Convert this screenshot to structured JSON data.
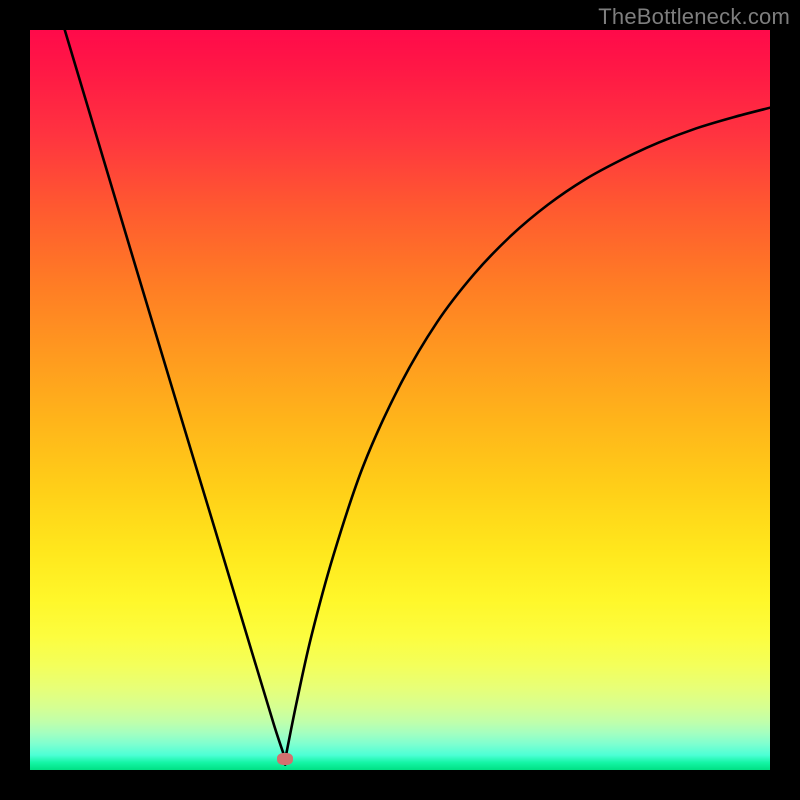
{
  "watermark": "TheBottleneck.com",
  "colors": {
    "outer": "#000000",
    "curve": "#000000",
    "marker": "#d2716f",
    "watermark": "#7e7e7e"
  },
  "marker": {
    "x_frac": 0.345,
    "y_frac": 0.985
  },
  "chart_data": {
    "type": "line",
    "title": "",
    "xlabel": "",
    "ylabel": "",
    "xlim": [
      0,
      1
    ],
    "ylim": [
      0,
      1
    ],
    "series": [
      {
        "name": "left-branch",
        "x": [
          0.047,
          0.1,
          0.15,
          0.2,
          0.25,
          0.3,
          0.33,
          0.345
        ],
        "values": [
          1.0,
          0.823,
          0.656,
          0.49,
          0.325,
          0.159,
          0.06,
          0.015
        ]
      },
      {
        "name": "right-branch",
        "x": [
          0.345,
          0.36,
          0.38,
          0.41,
          0.45,
          0.5,
          0.55,
          0.6,
          0.65,
          0.7,
          0.75,
          0.8,
          0.85,
          0.9,
          0.95,
          1.0
        ],
        "values": [
          0.015,
          0.09,
          0.18,
          0.29,
          0.41,
          0.52,
          0.605,
          0.67,
          0.722,
          0.764,
          0.798,
          0.825,
          0.848,
          0.867,
          0.882,
          0.895
        ]
      }
    ]
  }
}
